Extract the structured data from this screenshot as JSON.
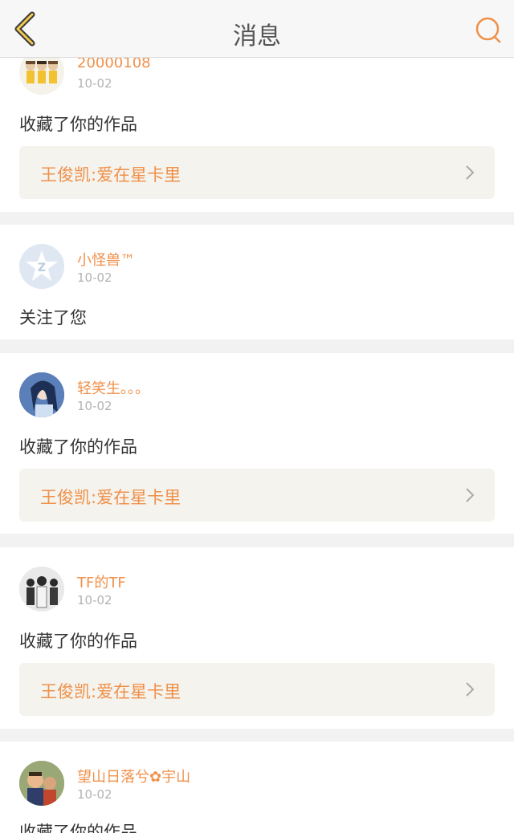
{
  "header": {
    "title": "消息",
    "back_icon": "chevron-left-icon",
    "search_icon": "search-icon",
    "accent_color": "#f0904a"
  },
  "notifications": [
    {
      "user": "20000108",
      "time": "10-02",
      "action": "收藏了你的作品",
      "work": "王俊凯:爱在星卡里"
    },
    {
      "user": "小怪兽™",
      "time": "10-02",
      "action": "关注了您"
    },
    {
      "user": "轻笑生。。。",
      "time": "10-02",
      "action": "收藏了你的作品",
      "work": "王俊凯:爱在星卡里"
    },
    {
      "user": "TF的TF",
      "time": "10-02",
      "action": "收藏了你的作品",
      "work": "王俊凯:爱在星卡里"
    },
    {
      "user": "望山日落兮✿宇山",
      "time": "10-02",
      "action": "收藏了你的作品"
    }
  ]
}
